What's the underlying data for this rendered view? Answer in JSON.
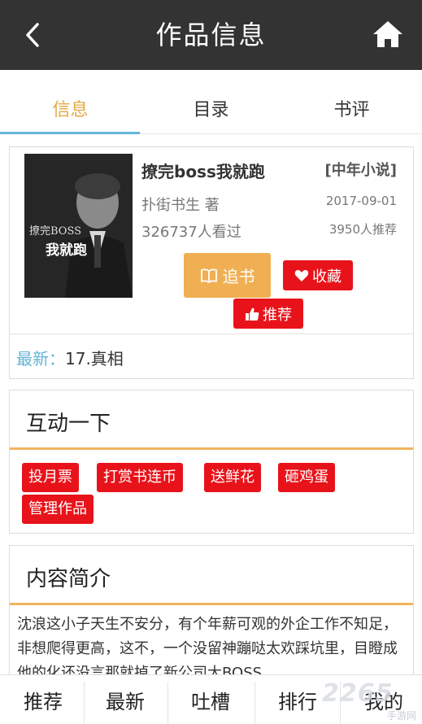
{
  "header": {
    "title": "作品信息"
  },
  "tabs": [
    {
      "label": "信息"
    },
    {
      "label": "目录"
    },
    {
      "label": "书评"
    }
  ],
  "book": {
    "name": "撩完boss我就跑",
    "category": "[中年小说]",
    "author": "扑街书生 著",
    "date": "2017-09-01",
    "views": "326737人看过",
    "recommends": "3950人推荐",
    "cover_text_1": "撩完BOSS",
    "cover_text_2": "我就跑"
  },
  "actions": {
    "follow": "追书",
    "collect": "收藏",
    "recommend": "推荐"
  },
  "latest": {
    "label": "最新：",
    "value": "17.真相"
  },
  "interact": {
    "title": "互动一下",
    "buttons": [
      "投月票",
      "打赏书连币",
      "送鲜花",
      "砸鸡蛋",
      "管理作品"
    ]
  },
  "intro": {
    "title": "内容简介",
    "text": "沈浪这小子天生不安分，有个年薪可观的外企工作不知足，非想爬得更高，这不，一个没留神蹦哒太欢踩坑里，目瞪成他的化还没言那就掉了新公司大BOSS"
  },
  "bottom_nav": [
    "推荐",
    "最新",
    "吐槽",
    "排行",
    "我的"
  ],
  "watermark": {
    "text": "2265",
    "sub": "手游网"
  },
  "colors": {
    "topbar": "#333333",
    "accent_orange": "#f0af52",
    "accent_blue": "#64b6d9",
    "red": "#e8131a"
  }
}
